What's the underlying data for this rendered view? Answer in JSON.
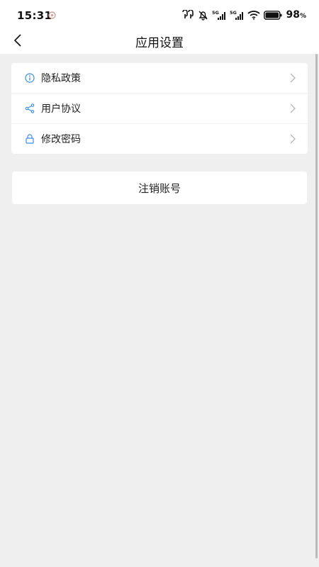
{
  "status_bar": {
    "time": "15:31",
    "battery_percent": "98",
    "battery_unit": "%",
    "network_1": "5G",
    "network_2": "5G"
  },
  "nav": {
    "title": "应用设置",
    "back_icon": "chevron-left-icon"
  },
  "settings": {
    "items": [
      {
        "label": "隐私政策",
        "icon": "info-icon"
      },
      {
        "label": "用户协议",
        "icon": "share-icon"
      },
      {
        "label": "修改密码",
        "icon": "lock-icon"
      }
    ]
  },
  "logout": {
    "label": "注销账号"
  },
  "colors": {
    "accent": "#3a8ee6",
    "background": "#efefef",
    "card": "#ffffff",
    "chevron": "#b5b5b5"
  }
}
